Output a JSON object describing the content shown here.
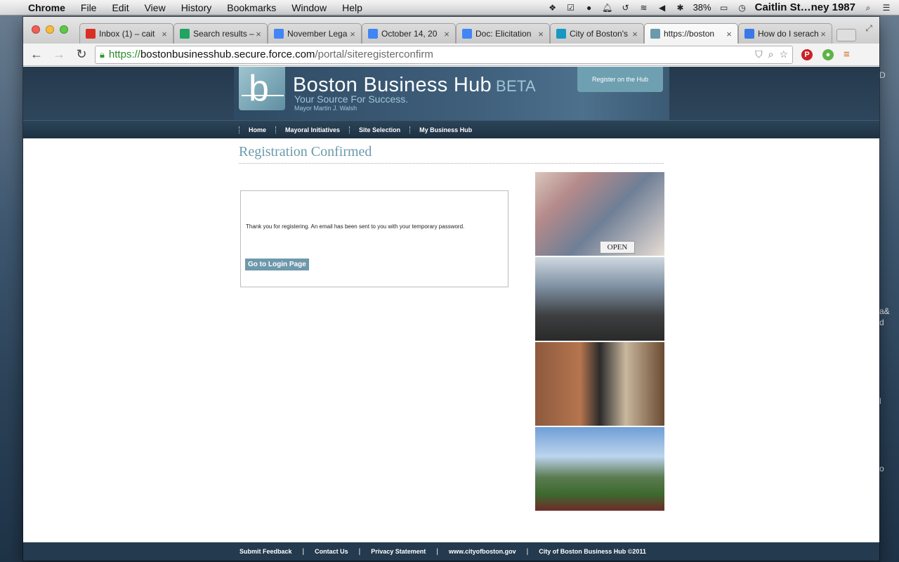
{
  "menubar": {
    "app": "Chrome",
    "items": [
      "File",
      "Edit",
      "View",
      "History",
      "Bookmarks",
      "Window",
      "Help"
    ],
    "battery": "38%",
    "user": "Caitlin St…ney 1987"
  },
  "tabs": [
    {
      "title": "Inbox (1) – cait",
      "icon": "gmail-icon",
      "color": "#d93025"
    },
    {
      "title": "Search results –",
      "icon": "drive-icon",
      "color": "#1fa463"
    },
    {
      "title": "November Lega",
      "icon": "docs-icon",
      "color": "#4285f4"
    },
    {
      "title": "October 14, 20",
      "icon": "docs-icon",
      "color": "#4285f4"
    },
    {
      "title": "Doc: Elicitation",
      "icon": "docs-icon",
      "color": "#4285f4"
    },
    {
      "title": "City of Boston's",
      "icon": "salesforce-icon",
      "color": "#1798c1"
    },
    {
      "title": "https://boston",
      "icon": "boston-hub-icon",
      "color": "#6a9aac",
      "active": true
    },
    {
      "title": "How do I serach",
      "icon": "help-icon",
      "color": "#3b78e7"
    }
  ],
  "address": {
    "scheme": "https://",
    "host": "bostonbusinesshub.secure.force.com",
    "path": "/portal/siteregisterconfirm"
  },
  "site": {
    "title": "Boston Business Hub",
    "beta": "BETA",
    "tagline": "Your Source For Success.",
    "mayor": "Mayor Martin J. Walsh",
    "register_label": "Register on the Hub",
    "nav": [
      "Home",
      "Mayoral Initiatives",
      "Site Selection",
      "My Business Hub"
    ]
  },
  "content": {
    "heading": "Registration Confirmed",
    "message": "Thank you for registering. An email has been sent to you with your temporary password.",
    "login_button": "Go to Login Page",
    "open_sign": "OPEN"
  },
  "footer": {
    "links": [
      "Submit Feedback",
      "Contact Us",
      "Privacy Statement",
      "www.cityofboston.gov",
      "City of Boston Business Hub ©2011"
    ]
  },
  "desktop_edge": [
    "D",
    "a&",
    "d",
    "l",
    "o"
  ]
}
